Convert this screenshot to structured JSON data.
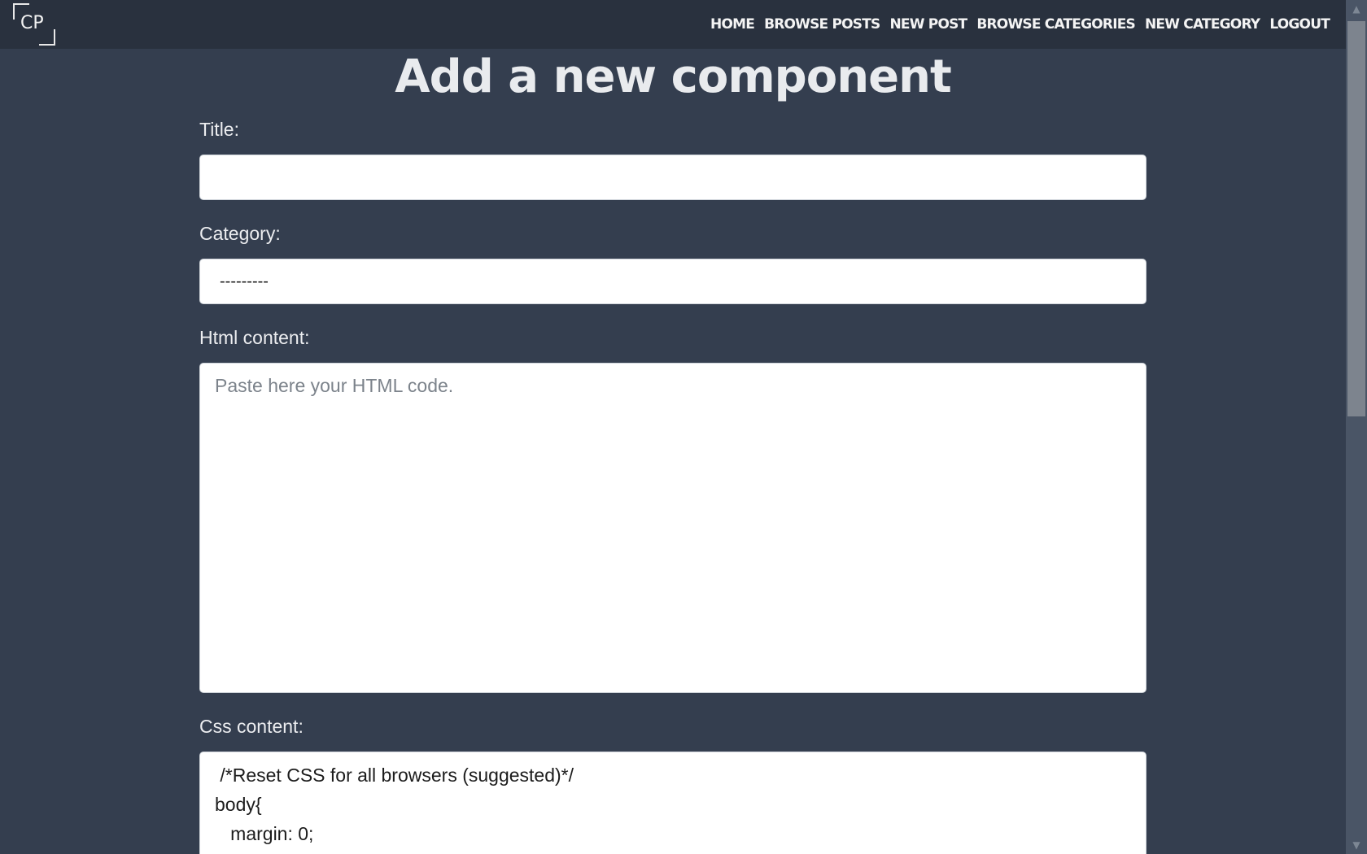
{
  "logo": {
    "text": "CP"
  },
  "nav": {
    "links": [
      "HOME",
      "BROWSE POSTS",
      "NEW POST",
      "BROWSE CATEGORIES",
      "NEW CATEGORY",
      "LOGOUT"
    ]
  },
  "page": {
    "title": "Add a new component"
  },
  "form": {
    "title_label": "Title:",
    "title_value": "",
    "category_label": "Category:",
    "category_value": "---------",
    "html_label": "Html content:",
    "html_placeholder": "Paste here your HTML code.",
    "css_label": "Css content:",
    "css_lines": [
      " /*Reset CSS for all browsers (suggested)*/",
      "body{",
      "   margin: 0;"
    ]
  },
  "scrollbar": {
    "up_icon": "triangle-up",
    "down_icon": "triangle-down"
  }
}
